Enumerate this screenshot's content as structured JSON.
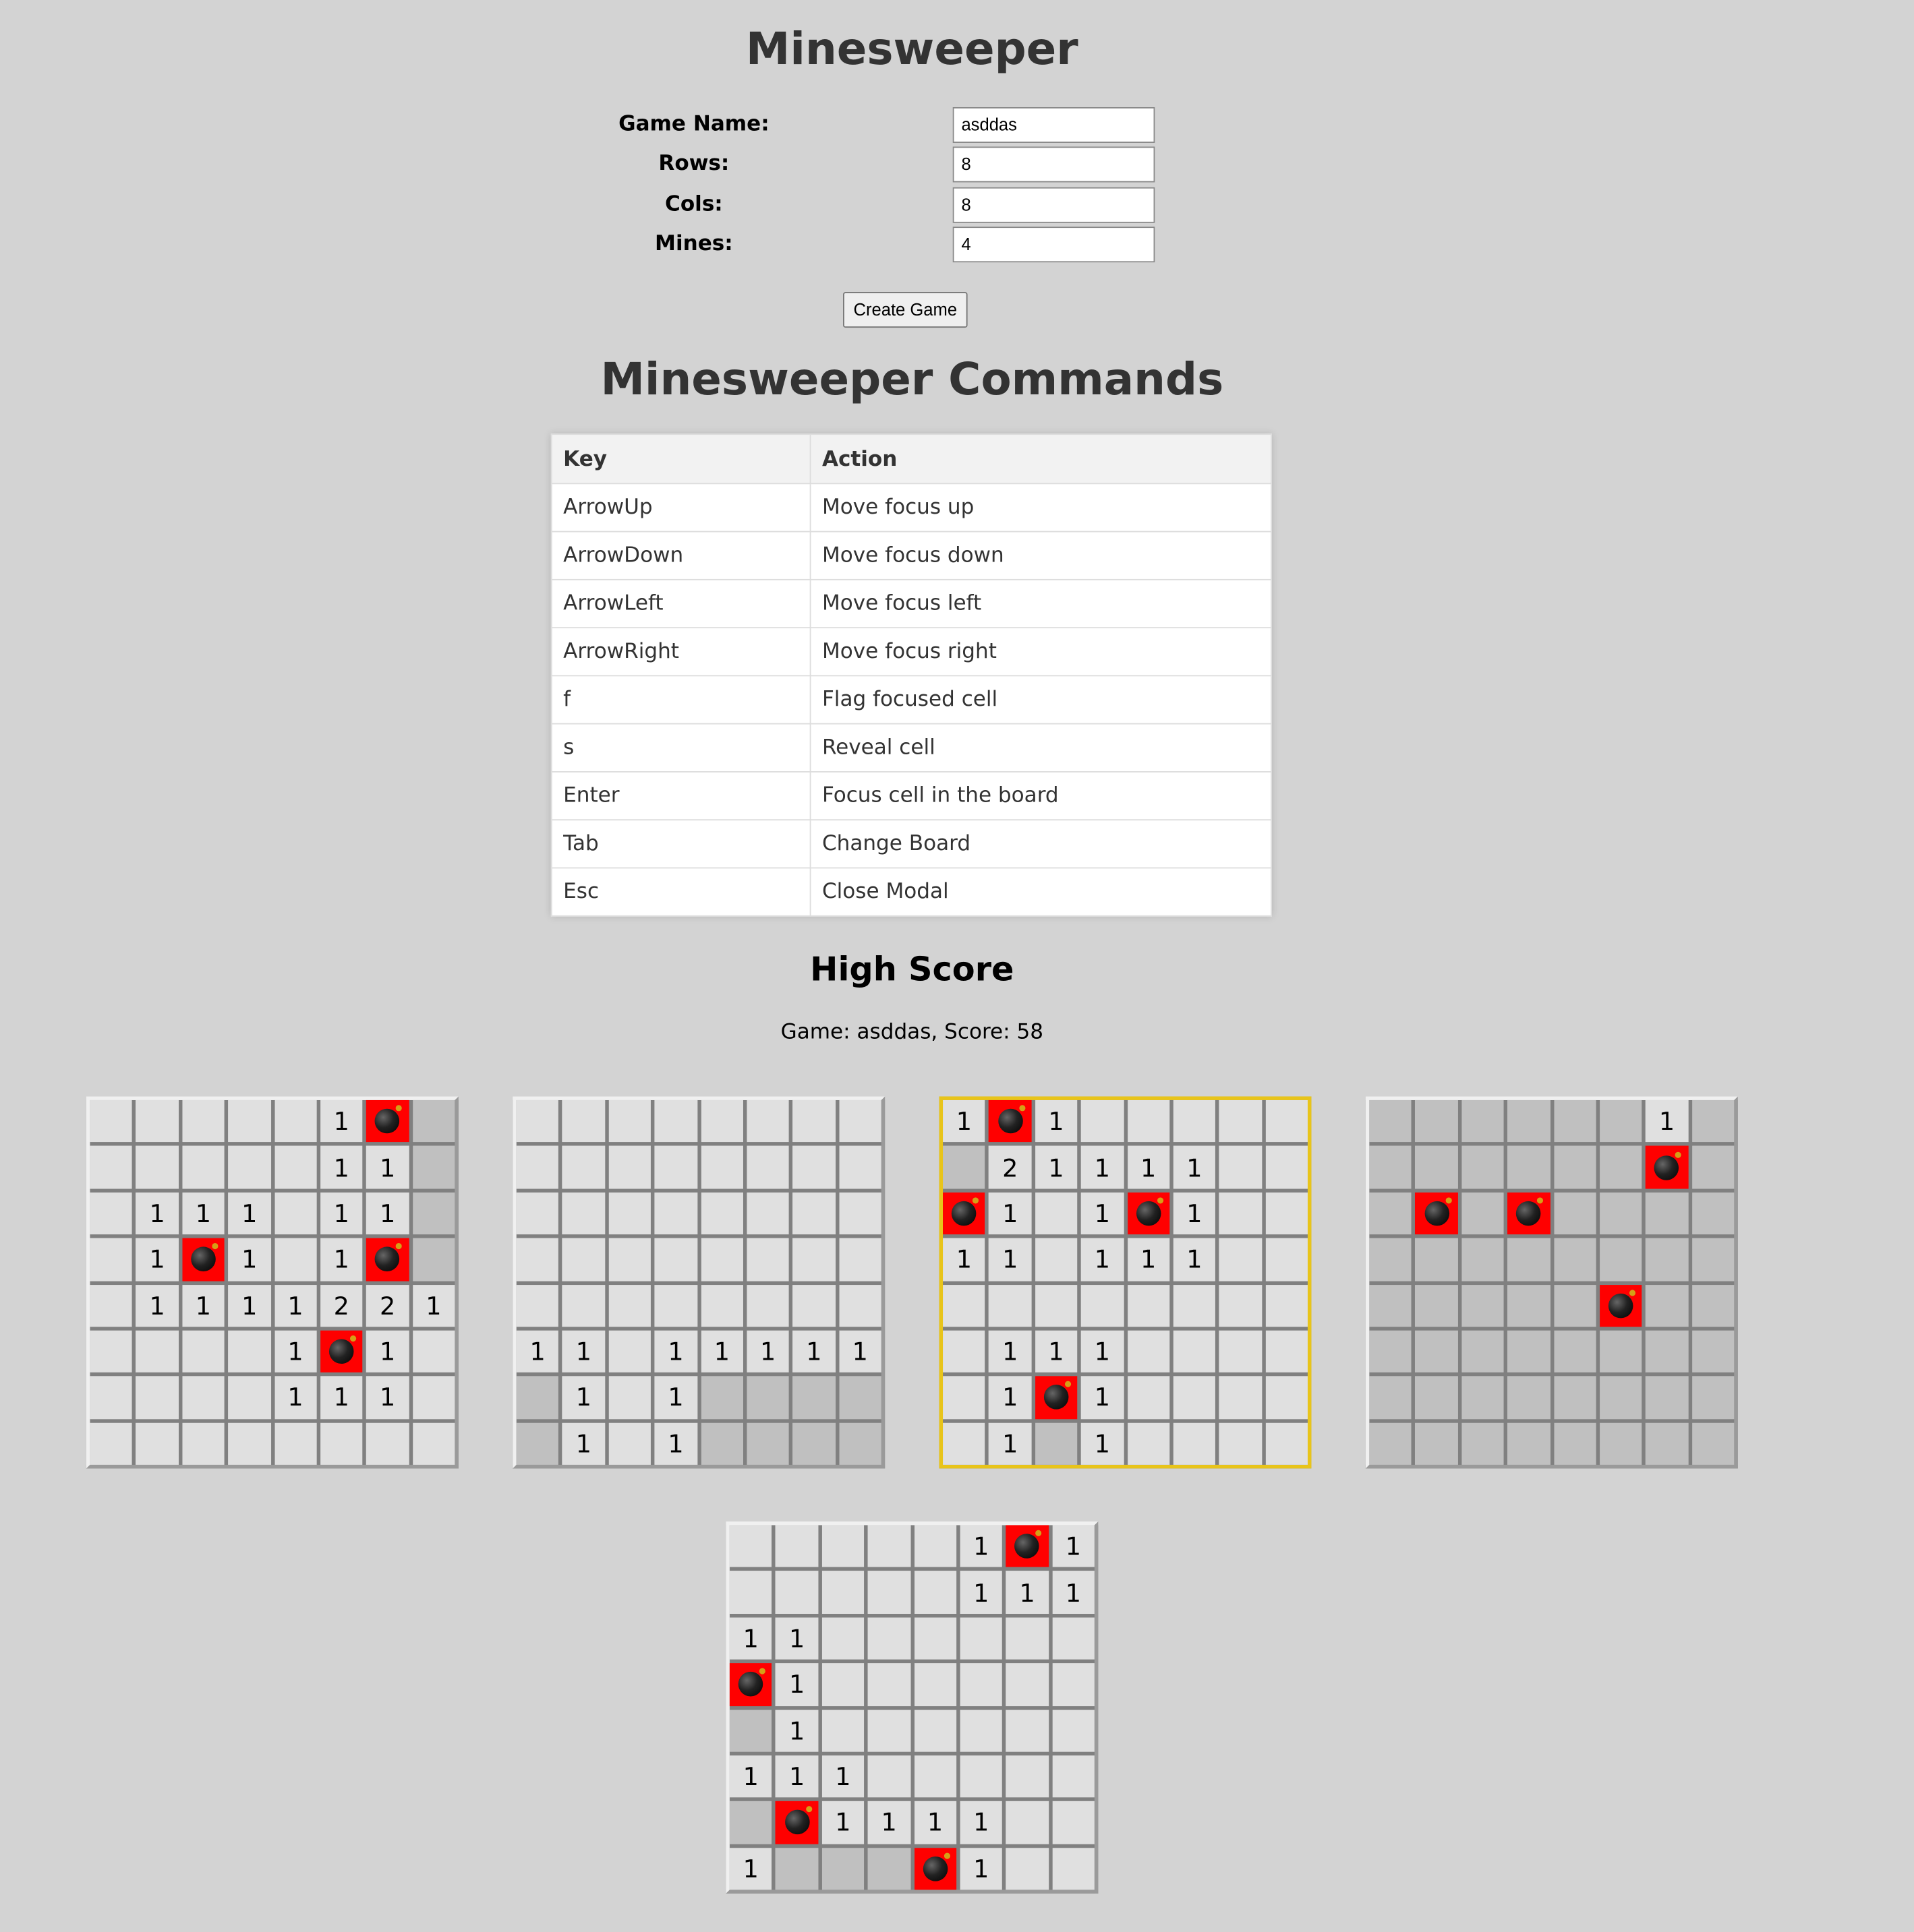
{
  "title": "Minesweeper",
  "form": {
    "game_name_label": "Game Name:",
    "game_name_value": "asddas",
    "rows_label": "Rows:",
    "rows_value": "8",
    "cols_label": "Cols:",
    "cols_value": "8",
    "mines_label": "Mines:",
    "mines_value": "4",
    "create_button": "Create Game"
  },
  "commands": {
    "title": "Minesweeper Commands",
    "headers": [
      "Key",
      "Action"
    ],
    "rows": [
      {
        "key": "ArrowUp",
        "action": "Move focus up"
      },
      {
        "key": "ArrowDown",
        "action": "Move focus down"
      },
      {
        "key": "ArrowLeft",
        "action": "Move focus left"
      },
      {
        "key": "ArrowRight",
        "action": "Move focus right"
      },
      {
        "key": "f",
        "action": "Flag focused cell"
      },
      {
        "key": "s",
        "action": "Reveal cell"
      },
      {
        "key": "Enter",
        "action": "Focus cell in the board"
      },
      {
        "key": "Tab",
        "action": "Change Board"
      },
      {
        "key": "Esc",
        "action": "Close Modal"
      }
    ]
  },
  "high_score": {
    "title": "High Score",
    "text": "Game: asddas, Score: 58"
  },
  "cell_legend": {
    "h": "hidden",
    "e": "revealed-empty",
    "m": "mine",
    "digit": "adjacent mine count"
  },
  "boards": [
    {
      "active": false,
      "cells": [
        [
          "e",
          "e",
          "e",
          "e",
          "e",
          "1",
          "m",
          "h"
        ],
        [
          "e",
          "e",
          "e",
          "e",
          "e",
          "1",
          "1",
          "h"
        ],
        [
          "e",
          "1",
          "1",
          "1",
          "e",
          "1",
          "1",
          "h"
        ],
        [
          "e",
          "1",
          "m",
          "1",
          "e",
          "1",
          "m",
          "h"
        ],
        [
          "e",
          "1",
          "1",
          "1",
          "1",
          "2",
          "2",
          "1"
        ],
        [
          "e",
          "e",
          "e",
          "e",
          "1",
          "m",
          "1",
          "e"
        ],
        [
          "e",
          "e",
          "e",
          "e",
          "1",
          "1",
          "1",
          "e"
        ],
        [
          "e",
          "e",
          "e",
          "e",
          "e",
          "e",
          "e",
          "e"
        ]
      ]
    },
    {
      "active": false,
      "cells": [
        [
          "e",
          "e",
          "e",
          "e",
          "e",
          "e",
          "e",
          "e"
        ],
        [
          "e",
          "e",
          "e",
          "e",
          "e",
          "e",
          "e",
          "e"
        ],
        [
          "e",
          "e",
          "e",
          "e",
          "e",
          "e",
          "e",
          "e"
        ],
        [
          "e",
          "e",
          "e",
          "e",
          "e",
          "e",
          "e",
          "e"
        ],
        [
          "e",
          "e",
          "e",
          "e",
          "e",
          "e",
          "e",
          "e"
        ],
        [
          "1",
          "1",
          "e",
          "1",
          "1",
          "1",
          "1",
          "1"
        ],
        [
          "h",
          "1",
          "e",
          "1",
          "h",
          "h",
          "h",
          "h"
        ],
        [
          "h",
          "1",
          "e",
          "1",
          "h",
          "h",
          "h",
          "h"
        ]
      ]
    },
    {
      "active": true,
      "cells": [
        [
          "1",
          "m",
          "1",
          "e",
          "e",
          "e",
          "e",
          "e"
        ],
        [
          "h",
          "2",
          "1",
          "1",
          "1",
          "1",
          "e",
          "e"
        ],
        [
          "m",
          "1",
          "e",
          "1",
          "m",
          "1",
          "e",
          "e"
        ],
        [
          "1",
          "1",
          "e",
          "1",
          "1",
          "1",
          "e",
          "e"
        ],
        [
          "e",
          "e",
          "e",
          "e",
          "e",
          "e",
          "e",
          "e"
        ],
        [
          "e",
          "1",
          "1",
          "1",
          "e",
          "e",
          "e",
          "e"
        ],
        [
          "e",
          "1",
          "m",
          "1",
          "e",
          "e",
          "e",
          "e"
        ],
        [
          "e",
          "1",
          "h",
          "1",
          "e",
          "e",
          "e",
          "e"
        ]
      ]
    },
    {
      "active": false,
      "cells": [
        [
          "h",
          "h",
          "h",
          "h",
          "h",
          "h",
          "1",
          "h"
        ],
        [
          "h",
          "h",
          "h",
          "h",
          "h",
          "h",
          "m",
          "h"
        ],
        [
          "h",
          "m",
          "h",
          "m",
          "h",
          "h",
          "h",
          "h"
        ],
        [
          "h",
          "h",
          "h",
          "h",
          "h",
          "h",
          "h",
          "h"
        ],
        [
          "h",
          "h",
          "h",
          "h",
          "h",
          "m",
          "h",
          "h"
        ],
        [
          "h",
          "h",
          "h",
          "h",
          "h",
          "h",
          "h",
          "h"
        ],
        [
          "h",
          "h",
          "h",
          "h",
          "h",
          "h",
          "h",
          "h"
        ],
        [
          "h",
          "h",
          "h",
          "h",
          "h",
          "h",
          "h",
          "h"
        ]
      ]
    },
    {
      "active": false,
      "cells": [
        [
          "e",
          "e",
          "e",
          "e",
          "e",
          "1",
          "m",
          "1"
        ],
        [
          "e",
          "e",
          "e",
          "e",
          "e",
          "1",
          "1",
          "1"
        ],
        [
          "1",
          "1",
          "e",
          "e",
          "e",
          "e",
          "e",
          "e"
        ],
        [
          "m",
          "1",
          "e",
          "e",
          "e",
          "e",
          "e",
          "e"
        ],
        [
          "h",
          "1",
          "e",
          "e",
          "e",
          "e",
          "e",
          "e"
        ],
        [
          "1",
          "1",
          "1",
          "e",
          "e",
          "e",
          "e",
          "e"
        ],
        [
          "h",
          "m",
          "1",
          "1",
          "1",
          "1",
          "e",
          "e"
        ],
        [
          "1",
          "h",
          "h",
          "h",
          "m",
          "1",
          "e",
          "e"
        ]
      ]
    }
  ]
}
